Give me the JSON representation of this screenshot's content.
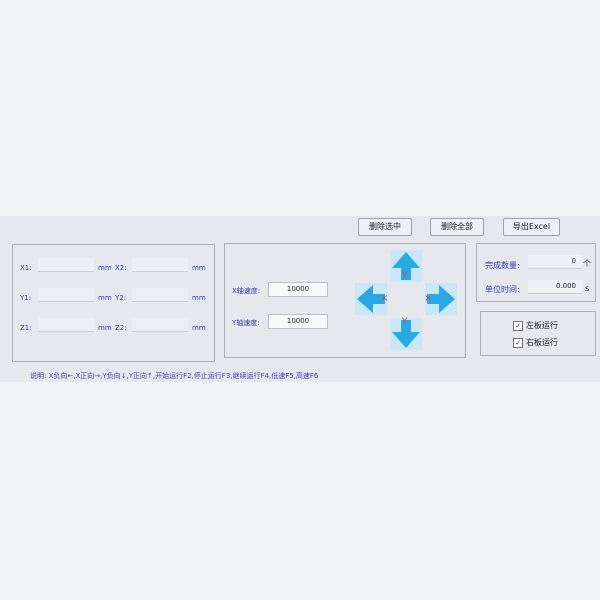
{
  "toolbar": {
    "delete_selected": "删除选中",
    "delete_all": "删除全部",
    "export_excel": "导出Excel"
  },
  "coords": {
    "x1_label": "X1:",
    "x2_label": "X2:",
    "y1_label": "Y1:",
    "y2_label": "Y2:",
    "z1_label": "Z1:",
    "z2_label": "Z2:",
    "unit": "mm"
  },
  "speed": {
    "x_label": "X轴速度:",
    "x_value": "10000",
    "y_label": "Y轴速度:",
    "y_value": "10000"
  },
  "jog": {
    "y_letter": "Y",
    "x_mark": "×",
    "arrow_color": "#29a9e4"
  },
  "stats": {
    "count_label": "完成数量:",
    "count_value": "0",
    "count_unit": "个",
    "time_label": "单位时间:",
    "time_value": "0.000",
    "time_unit": "s"
  },
  "run": {
    "left_label": "左板运行",
    "left_checked": true,
    "right_label": "右板运行",
    "right_checked": true
  },
  "instructions": "说明: X负向←,X正向→,Y负向↓,Y正向↑,开始运行F2,停止运行F3,继续运行F4,低速F5,高速F6"
}
